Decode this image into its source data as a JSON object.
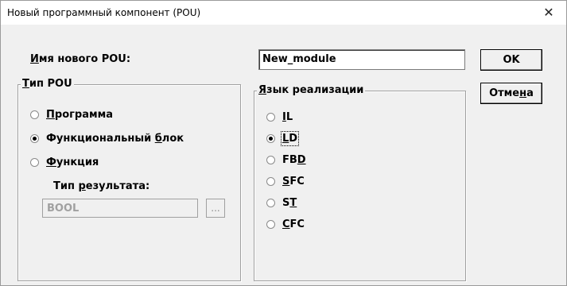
{
  "window": {
    "title": "Новый программный компонент (POU)",
    "close_glyph": "✕"
  },
  "name_field": {
    "label_hot": "И",
    "label_rest": "мя нового POU:",
    "value": "New_module"
  },
  "buttons": {
    "ok": {
      "label": "OK"
    },
    "cancel": {
      "pre": "Отме",
      "hot": "н",
      "post": "а"
    }
  },
  "pou_type": {
    "legend_hot": "Т",
    "legend_rest": "ип POU",
    "options": [
      {
        "pre": "",
        "hot": "П",
        "post": "рограмма",
        "selected": false
      },
      {
        "pre": "Функциональный ",
        "hot": "б",
        "post": "лок",
        "selected": true
      },
      {
        "pre": "",
        "hot": "Ф",
        "post": "ункция",
        "selected": false
      }
    ],
    "result_type": {
      "label_pre": "Тип ",
      "label_hot": "р",
      "label_post": "езультата:",
      "value": "BOOL",
      "browse_label": "..."
    }
  },
  "language": {
    "legend_hot": "Я",
    "legend_rest": "зык реализации",
    "options": [
      {
        "pre": "",
        "hot": "I",
        "post": "L",
        "selected": false
      },
      {
        "pre": "",
        "hot": "L",
        "post": "D",
        "selected": true
      },
      {
        "pre": "FB",
        "hot": "D",
        "post": "",
        "selected": false
      },
      {
        "pre": "",
        "hot": "S",
        "post": "FC",
        "selected": false
      },
      {
        "pre": "S",
        "hot": "T",
        "post": "",
        "selected": false
      },
      {
        "pre": "",
        "hot": "C",
        "post": "FC",
        "selected": false
      }
    ]
  }
}
